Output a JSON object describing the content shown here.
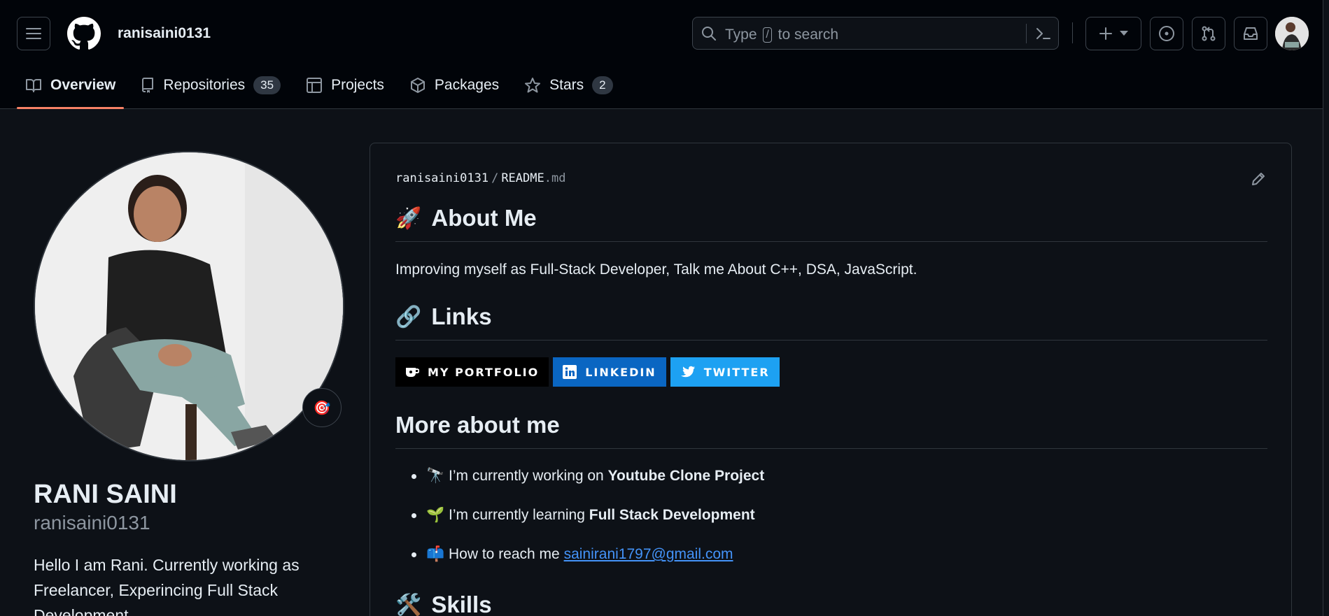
{
  "header": {
    "username": "ranisaini0131",
    "search_prefix": "Type",
    "search_key": "/",
    "search_suffix": "to search"
  },
  "tabs": [
    {
      "label": "Overview",
      "icon": "book-icon",
      "active": true
    },
    {
      "label": "Repositories",
      "icon": "repo-icon",
      "count": "35"
    },
    {
      "label": "Projects",
      "icon": "table-icon"
    },
    {
      "label": "Packages",
      "icon": "package-icon"
    },
    {
      "label": "Stars",
      "icon": "star-icon",
      "count": "2"
    }
  ],
  "profile": {
    "full_name": "RANI SAINI",
    "login": "ranisaini0131",
    "bio": "Hello I am Rani. Currently working as Freelancer, Experincing Full Stack Development",
    "status_emoji": "🎯"
  },
  "readme": {
    "owner": "ranisaini0131",
    "file": "README",
    "ext": ".md",
    "about_heading": "About Me",
    "about_emoji": "🚀",
    "about_text": "Improving myself as Full-Stack Developer, Talk me About C++, DSA, JavaScript.",
    "links_heading": "Links",
    "links_emoji": "🔗",
    "badges": [
      {
        "label": "MY PORTFOLIO",
        "color": "#000000",
        "icon": "cup-icon"
      },
      {
        "label": "LINKEDIN",
        "color": "#0a66c2",
        "icon": "linkedin-icon"
      },
      {
        "label": "TWITTER",
        "color": "#1da1f2",
        "icon": "twitter-icon"
      }
    ],
    "more_heading": "More about me",
    "items": [
      {
        "emoji": "🔭",
        "text": "I’m currently working on ",
        "bold": "Youtube Clone Project"
      },
      {
        "emoji": "🌱",
        "text": "I’m currently learning ",
        "bold": "Full Stack Development"
      },
      {
        "emoji": "📫",
        "text": "How to reach me ",
        "link": "sainirani1797@gmail.com"
      }
    ],
    "skills_heading": "Skills",
    "skills_emoji": "🛠️"
  },
  "colors": {
    "accent_underline": "#f78166",
    "link": "#4493f8",
    "bg": "#0d1117"
  }
}
